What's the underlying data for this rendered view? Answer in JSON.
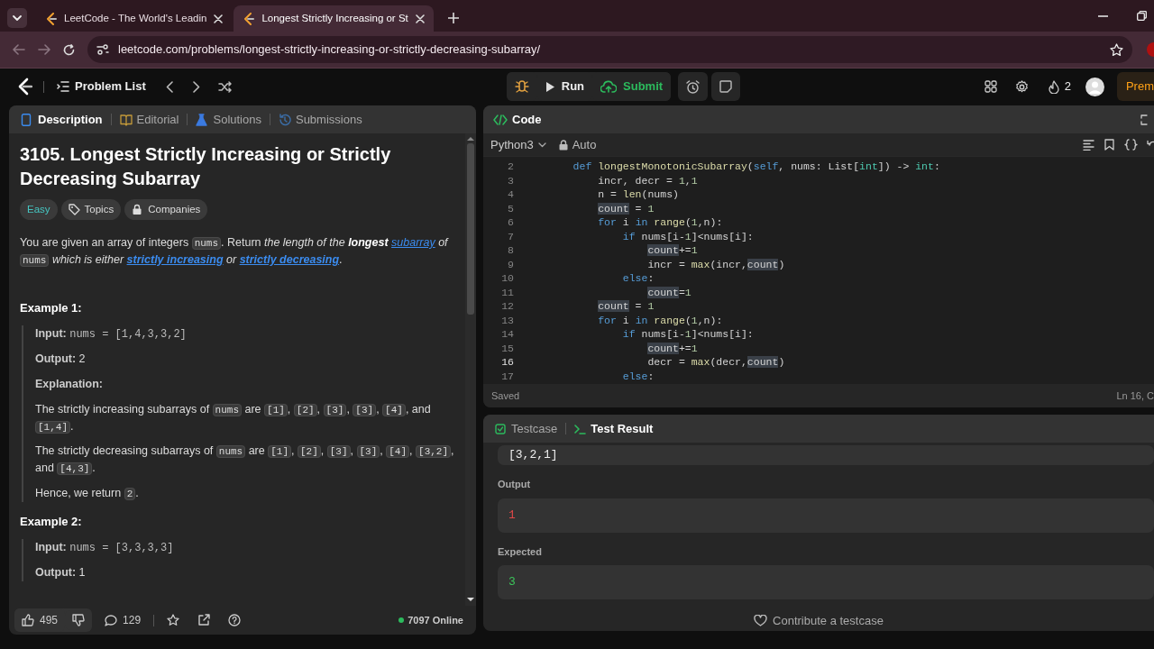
{
  "browser": {
    "tabs": [
      {
        "title": "LeetCode - The World's Leadin",
        "selected": false
      },
      {
        "title": "Longest Strictly Increasing or St",
        "selected": true
      }
    ],
    "url": "leetcode.com/problems/longest-strictly-increasing-or-strictly-decreasing-subarray/"
  },
  "toolbar": {
    "problem_list": "Problem List",
    "run": "Run",
    "submit": "Submit",
    "streak": "2",
    "premium": "Prem"
  },
  "description_panel": {
    "tabs": [
      {
        "label": "Description",
        "selected": true
      },
      {
        "label": "Editorial",
        "selected": false
      },
      {
        "label": "Solutions",
        "selected": false
      },
      {
        "label": "Submissions",
        "selected": false
      }
    ],
    "title": "3105. Longest Strictly Increasing or Strictly Decreasing Subarray",
    "difficulty": "Easy",
    "tags": [
      "Topics",
      "Companies"
    ],
    "statement": [
      {
        "text": "You are given an array of integers ",
        "kind": "text"
      },
      {
        "text": "nums",
        "kind": "code"
      },
      {
        "text": ". Return ",
        "kind": "text"
      },
      {
        "text": "the length of the ",
        "kind": "em"
      },
      {
        "text": "longest ",
        "kind": "em-strong"
      },
      {
        "text": "subarray",
        "kind": "em-link"
      },
      {
        "text": " of ",
        "kind": "em"
      },
      {
        "text": "nums",
        "kind": "code"
      },
      {
        "text": " which is either ",
        "kind": "em"
      },
      {
        "text": "strictly increasing",
        "kind": "em-strong-link"
      },
      {
        "text": " or ",
        "kind": "em"
      },
      {
        "text": "strictly decreasing",
        "kind": "em-strong-link"
      },
      {
        "text": ".",
        "kind": "text"
      }
    ],
    "examples": [
      {
        "title": "Example 1:",
        "input_label": "Input:",
        "input": "nums = [1,4,3,3,2]",
        "output_label": "Output:",
        "output": "2",
        "explanation_label": "Explanation:",
        "explanation": [
          [
            {
              "text": "The strictly increasing subarrays of ",
              "kind": "text"
            },
            {
              "text": "nums",
              "kind": "code"
            },
            {
              "text": " are ",
              "kind": "text"
            },
            {
              "text": "[1]",
              "kind": "code"
            },
            {
              "text": ", ",
              "kind": "text"
            },
            {
              "text": "[2]",
              "kind": "code"
            },
            {
              "text": ", ",
              "kind": "text"
            },
            {
              "text": "[3]",
              "kind": "code"
            },
            {
              "text": ", ",
              "kind": "text"
            },
            {
              "text": "[3]",
              "kind": "code"
            },
            {
              "text": ", ",
              "kind": "text"
            },
            {
              "text": "[4]",
              "kind": "code"
            },
            {
              "text": ", and ",
              "kind": "text"
            },
            {
              "text": "[1,4]",
              "kind": "code"
            },
            {
              "text": ".",
              "kind": "text"
            }
          ],
          [
            {
              "text": "The strictly decreasing subarrays of ",
              "kind": "text"
            },
            {
              "text": "nums",
              "kind": "code"
            },
            {
              "text": " are ",
              "kind": "text"
            },
            {
              "text": "[1]",
              "kind": "code"
            },
            {
              "text": ", ",
              "kind": "text"
            },
            {
              "text": "[2]",
              "kind": "code"
            },
            {
              "text": ", ",
              "kind": "text"
            },
            {
              "text": "[3]",
              "kind": "code"
            },
            {
              "text": ", ",
              "kind": "text"
            },
            {
              "text": "[3]",
              "kind": "code"
            },
            {
              "text": ", ",
              "kind": "text"
            },
            {
              "text": "[4]",
              "kind": "code"
            },
            {
              "text": ", ",
              "kind": "text"
            },
            {
              "text": "[3,2]",
              "kind": "code"
            },
            {
              "text": ", and ",
              "kind": "text"
            },
            {
              "text": "[4,3]",
              "kind": "code"
            },
            {
              "text": ".",
              "kind": "text"
            }
          ],
          [
            {
              "text": "Hence, we return ",
              "kind": "text"
            },
            {
              "text": "2",
              "kind": "code"
            },
            {
              "text": ".",
              "kind": "text"
            }
          ]
        ]
      },
      {
        "title": "Example 2:",
        "input_label": "Input:",
        "input": "nums = [3,3,3,3]",
        "output_label": "Output:",
        "output": "1"
      }
    ],
    "footer": {
      "likes": "495",
      "comments": "129",
      "online": "7097 Online"
    }
  },
  "code_panel": {
    "title": "Code",
    "language": "Python3",
    "mode": "Auto",
    "status": "Saved",
    "position": "Ln 16, C",
    "lines": [
      {
        "number": "2",
        "current": false,
        "tokens": [
          {
            "text": "def ",
            "kind": "kw"
          },
          {
            "text": "longestMonotonicSubarray",
            "kind": "fn"
          },
          {
            "text": "(",
            "kind": "plain"
          },
          {
            "text": "self",
            "kind": "kw"
          },
          {
            "text": ", nums: List[",
            "kind": "plain"
          },
          {
            "text": "int",
            "kind": "type"
          },
          {
            "text": "]) -> ",
            "kind": "plain"
          },
          {
            "text": "int",
            "kind": "type"
          },
          {
            "text": ":",
            "kind": "plain"
          }
        ],
        "children": [
          {
            "number": "3",
            "current": false,
            "tokens": [
              {
                "text": "incr, decr = ",
                "kind": "plain"
              },
              {
                "text": "1",
                "kind": "num"
              },
              {
                "text": ",",
                "kind": "plain"
              },
              {
                "text": "1",
                "kind": "num"
              }
            ]
          },
          {
            "number": "4",
            "current": false,
            "tokens": [
              {
                "text": "n = ",
                "kind": "plain"
              },
              {
                "text": "len",
                "kind": "fn"
              },
              {
                "text": "(nums)",
                "kind": "plain"
              }
            ]
          },
          {
            "number": "5",
            "current": false,
            "tokens": [
              {
                "text": "count",
                "kind": "match"
              },
              {
                "text": " = ",
                "kind": "plain"
              },
              {
                "text": "1",
                "kind": "num"
              }
            ]
          },
          {
            "number": "6",
            "current": false,
            "tokens": [
              {
                "text": "for",
                "kind": "kw"
              },
              {
                "text": " i ",
                "kind": "plain"
              },
              {
                "text": "in ",
                "kind": "kw"
              },
              {
                "text": "range",
                "kind": "fn"
              },
              {
                "text": "(",
                "kind": "plain"
              },
              {
                "text": "1",
                "kind": "num"
              },
              {
                "text": ",n):",
                "kind": "plain"
              }
            ],
            "children": [
              {
                "number": "7",
                "current": false,
                "tokens": [
                  {
                    "text": "if",
                    "kind": "kw"
                  },
                  {
                    "text": " nums[i-",
                    "kind": "plain"
                  },
                  {
                    "text": "1",
                    "kind": "num"
                  },
                  {
                    "text": "]<nums[i]:",
                    "kind": "plain"
                  }
                ],
                "children": [
                  {
                    "number": "8",
                    "current": false,
                    "tokens": [
                      {
                        "text": "count",
                        "kind": "match"
                      },
                      {
                        "text": "+=",
                        "kind": "plain"
                      },
                      {
                        "text": "1",
                        "kind": "num"
                      }
                    ]
                  },
                  {
                    "number": "9",
                    "current": false,
                    "tokens": [
                      {
                        "text": "incr = ",
                        "kind": "plain"
                      },
                      {
                        "text": "max",
                        "kind": "fn"
                      },
                      {
                        "text": "(incr,",
                        "kind": "plain"
                      },
                      {
                        "text": "count",
                        "kind": "match"
                      },
                      {
                        "text": ")",
                        "kind": "plain"
                      }
                    ]
                  }
                ]
              },
              {
                "number": "10",
                "current": false,
                "tokens": [
                  {
                    "text": "else",
                    "kind": "kw"
                  },
                  {
                    "text": ":",
                    "kind": "plain"
                  }
                ],
                "children": [
                  {
                    "number": "11",
                    "current": false,
                    "tokens": [
                      {
                        "text": "count",
                        "kind": "match"
                      },
                      {
                        "text": "=",
                        "kind": "plain"
                      },
                      {
                        "text": "1",
                        "kind": "num"
                      }
                    ]
                  }
                ]
              }
            ]
          },
          {
            "number": "12",
            "current": false,
            "tokens": [
              {
                "text": "count",
                "kind": "match"
              },
              {
                "text": " = ",
                "kind": "plain"
              },
              {
                "text": "1",
                "kind": "num"
              }
            ]
          },
          {
            "number": "13",
            "current": false,
            "tokens": [
              {
                "text": "for",
                "kind": "kw"
              },
              {
                "text": " i ",
                "kind": "plain"
              },
              {
                "text": "in ",
                "kind": "kw"
              },
              {
                "text": "range",
                "kind": "fn"
              },
              {
                "text": "(",
                "kind": "plain"
              },
              {
                "text": "1",
                "kind": "num"
              },
              {
                "text": ",n):",
                "kind": "plain"
              }
            ],
            "children": [
              {
                "number": "14",
                "current": false,
                "tokens": [
                  {
                    "text": "if",
                    "kind": "kw"
                  },
                  {
                    "text": " nums[i-",
                    "kind": "plain"
                  },
                  {
                    "text": "1",
                    "kind": "num"
                  },
                  {
                    "text": "]<nums[i]:",
                    "kind": "plain"
                  }
                ],
                "children": [
                  {
                    "number": "15",
                    "current": false,
                    "tokens": [
                      {
                        "text": "count",
                        "kind": "match"
                      },
                      {
                        "text": "+=",
                        "kind": "plain"
                      },
                      {
                        "text": "1",
                        "kind": "num"
                      }
                    ]
                  },
                  {
                    "number": "16",
                    "current": true,
                    "tokens": [
                      {
                        "text": "decr = ",
                        "kind": "plain"
                      },
                      {
                        "text": "max",
                        "kind": "fn"
                      },
                      {
                        "text": "(decr,",
                        "kind": "plain"
                      },
                      {
                        "text": "count",
                        "kind": "match"
                      },
                      {
                        "text": ")",
                        "kind": "plain"
                      }
                    ]
                  }
                ]
              },
              {
                "number": "17",
                "current": false,
                "tokens": [
                  {
                    "text": "else",
                    "kind": "kw"
                  },
                  {
                    "text": ":",
                    "kind": "plain"
                  }
                ]
              }
            ]
          }
        ]
      }
    ]
  },
  "test_panel": {
    "tabs": [
      {
        "label": "Testcase",
        "selected": false
      },
      {
        "label": "Test Result",
        "selected": true
      }
    ],
    "input": "[3,2,1]",
    "results": [
      {
        "label": "Output",
        "value": "1",
        "kind": "wrong"
      },
      {
        "label": "Expected",
        "value": "3",
        "kind": "expected"
      }
    ],
    "contribute": "Contribute a testcase"
  }
}
